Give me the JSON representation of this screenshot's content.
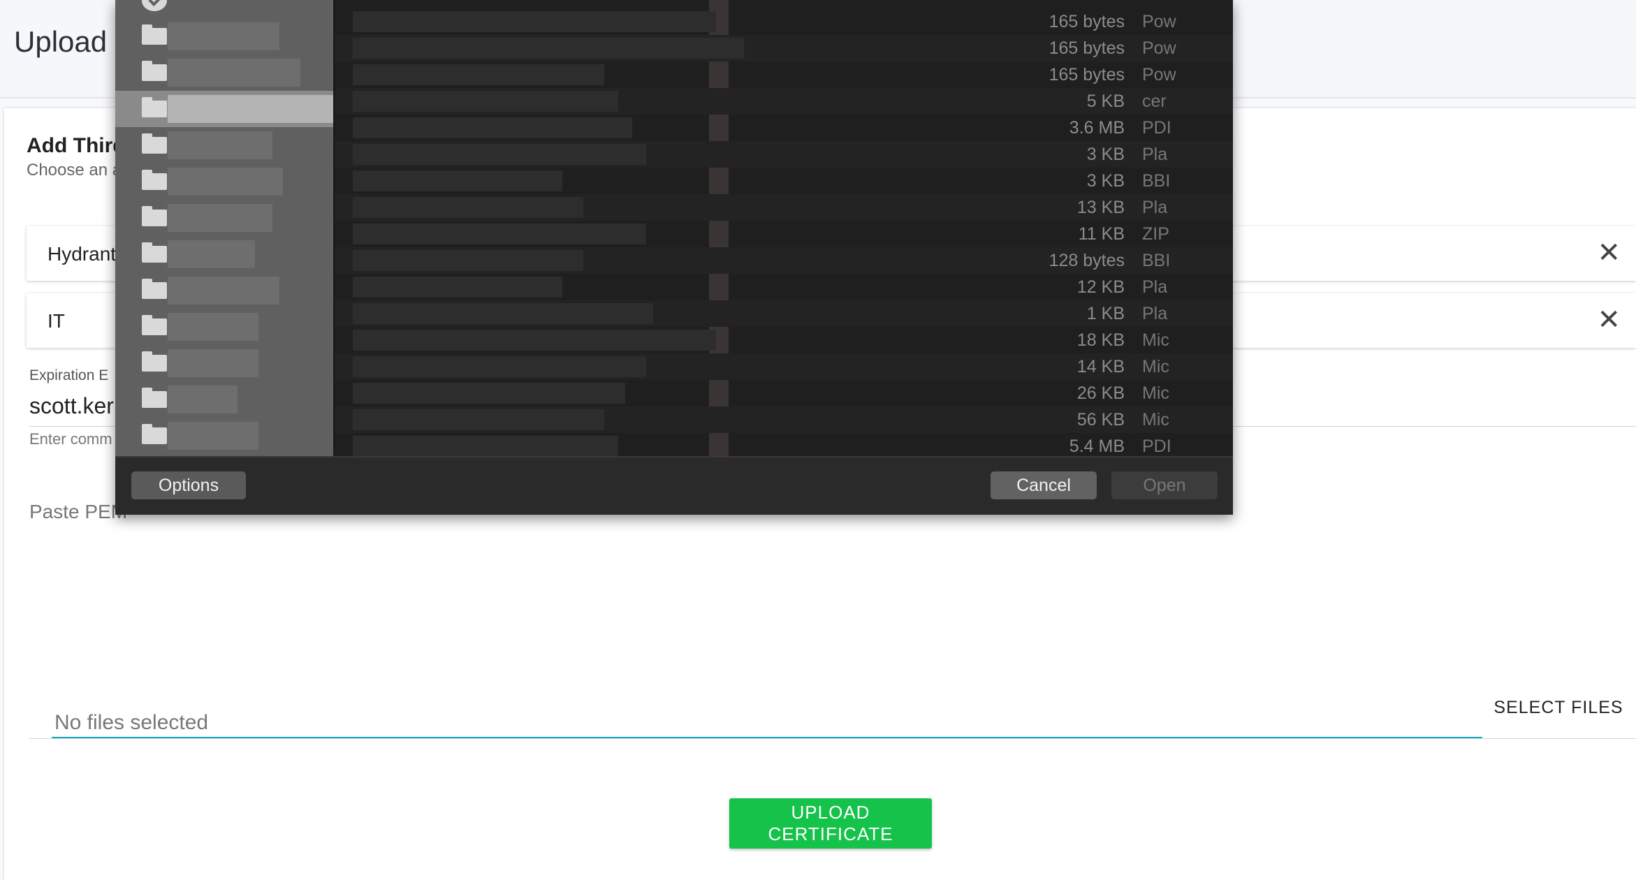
{
  "page": {
    "title": "Upload",
    "card_title": "Add Third",
    "card_subtitle": "Choose an a"
  },
  "chips": [
    {
      "label": "Hydrant"
    },
    {
      "label": "IT"
    }
  ],
  "close_glyph": "✕",
  "form": {
    "expiration_label": "Expiration E",
    "email_value": "scott.ker",
    "email_hint": "Enter comm",
    "pem_placeholder": "Paste PEM",
    "file_placeholder": "No files selected",
    "select_files_label": "SELECT FILES",
    "upload_label": "UPLOAD CERTIFICATE"
  },
  "file_dialog": {
    "options_label": "Options",
    "cancel_label": "Cancel",
    "open_label": "Open",
    "sidebar_selected_index": 2,
    "files": [
      {
        "size": "165 bytes",
        "kind": "Pow"
      },
      {
        "size": "165 bytes",
        "kind": "Pow"
      },
      {
        "size": "165 bytes",
        "kind": "Pow"
      },
      {
        "size": "5 KB",
        "kind": "cer"
      },
      {
        "size": "3.6 MB",
        "kind": "PDI"
      },
      {
        "size": "3 KB",
        "kind": "Pla"
      },
      {
        "size": "3 KB",
        "kind": "BBI"
      },
      {
        "size": "13 KB",
        "kind": "Pla"
      },
      {
        "size": "11 KB",
        "kind": "ZIP"
      },
      {
        "size": "128 bytes",
        "kind": "BBI"
      },
      {
        "size": "12 KB",
        "kind": "Pla"
      },
      {
        "size": "1 KB",
        "kind": "Pla"
      },
      {
        "size": "18 KB",
        "kind": "Mic"
      },
      {
        "size": "14 KB",
        "kind": "Mic"
      },
      {
        "size": "26 KB",
        "kind": "Mic"
      },
      {
        "size": "56 KB",
        "kind": "Mic"
      },
      {
        "size": "5.4 MB",
        "kind": "PDI"
      }
    ]
  }
}
